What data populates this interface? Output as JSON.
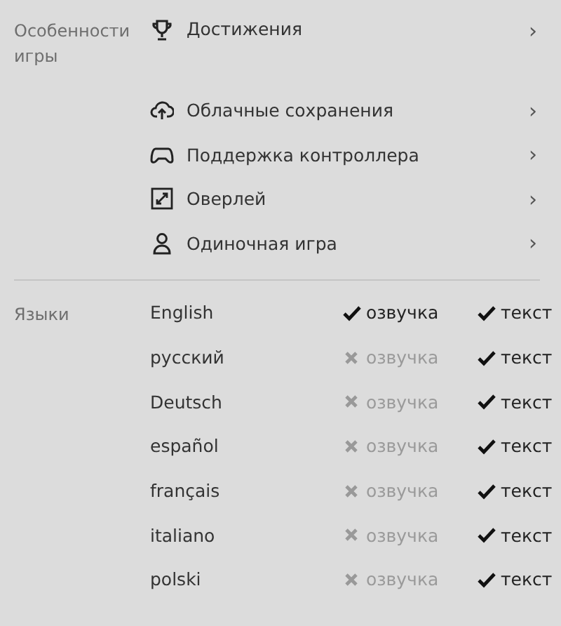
{
  "features": {
    "label": "Особенности игры",
    "items": [
      {
        "label": "Достижения",
        "chevron": "›"
      },
      {
        "label": "Облачные сохранения",
        "chevron": "›"
      },
      {
        "label": "Поддержка контроллера",
        "chevron": "›"
      },
      {
        "label": "Оверлей",
        "chevron": "›"
      },
      {
        "label": "Одиночная игра",
        "chevron": "›"
      }
    ]
  },
  "languages": {
    "label": "Языки",
    "items": [
      {
        "name": "English",
        "voice": {
          "label": "озвучка",
          "available": true
        },
        "text": {
          "label": "текст",
          "available": true
        }
      },
      {
        "name": "русский",
        "voice": {
          "label": "озвучка",
          "available": false
        },
        "text": {
          "label": "текст",
          "available": true
        }
      },
      {
        "name": "Deutsch",
        "voice": {
          "label": "озвучка",
          "available": false
        },
        "text": {
          "label": "текст",
          "available": true
        }
      },
      {
        "name": "español",
        "voice": {
          "label": "озвучка",
          "available": false
        },
        "text": {
          "label": "текст",
          "available": true
        }
      },
      {
        "name": "français",
        "voice": {
          "label": "озвучка",
          "available": false
        },
        "text": {
          "label": "текст",
          "available": true
        }
      },
      {
        "name": "italiano",
        "voice": {
          "label": "озвучка",
          "available": false
        },
        "text": {
          "label": "текст",
          "available": true
        }
      },
      {
        "name": "polski",
        "voice": {
          "label": "озвучка",
          "available": false
        },
        "text": {
          "label": "текст",
          "available": true
        }
      }
    ]
  }
}
